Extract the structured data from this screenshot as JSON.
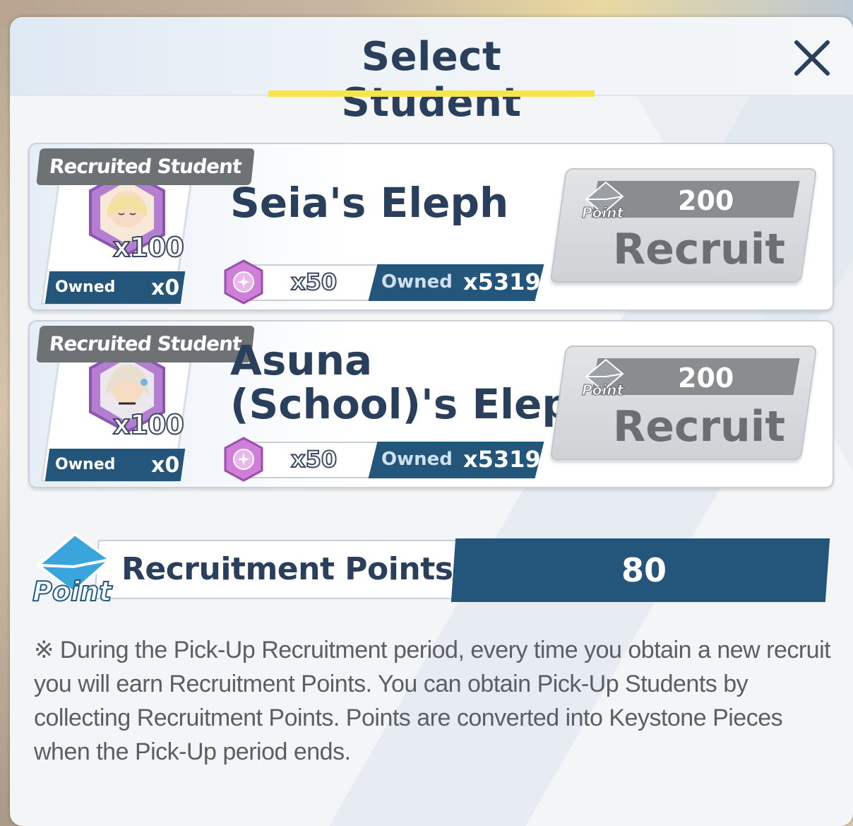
{
  "dialog": {
    "title": "Select Student"
  },
  "cards": [
    {
      "tag": "Recruited Student",
      "name": "Seia's Eleph",
      "portrait_qty": "x100",
      "owned_label": "Owned",
      "owned_value": "x0",
      "cost_qty": "x50",
      "cost_owned_label": "Owned",
      "cost_owned_value": "x5319",
      "button": {
        "point_icon": "point-envelope-icon",
        "cost": "200",
        "label": "Recruit"
      }
    },
    {
      "tag": "Recruited Student",
      "name_line1": "Asuna",
      "name_line2": "(School)'s Eleph",
      "portrait_qty": "x100",
      "owned_label": "Owned",
      "owned_value": "x0",
      "cost_qty": "x50",
      "cost_owned_label": "Owned",
      "cost_owned_value": "x5319",
      "button": {
        "point_icon": "point-envelope-icon",
        "cost": "200",
        "label": "Recruit"
      }
    }
  ],
  "recruitment_points": {
    "label": "Recruitment Points",
    "value": "80",
    "icon": "point-envelope-icon"
  },
  "note": "※ During the Pick-Up Recruitment period, every time you obtain a new recruit you will earn Recruitment Points. You can obtain Pick-Up Students by collecting Recruitment Points. Points are converted into Keystone Pieces when the Pick-Up period ends.",
  "colors": {
    "title": "#2a3f5c",
    "accent_blue": "#24557a",
    "underline_yellow": "#f5e54a",
    "disabled_button": "#d4d7da"
  }
}
